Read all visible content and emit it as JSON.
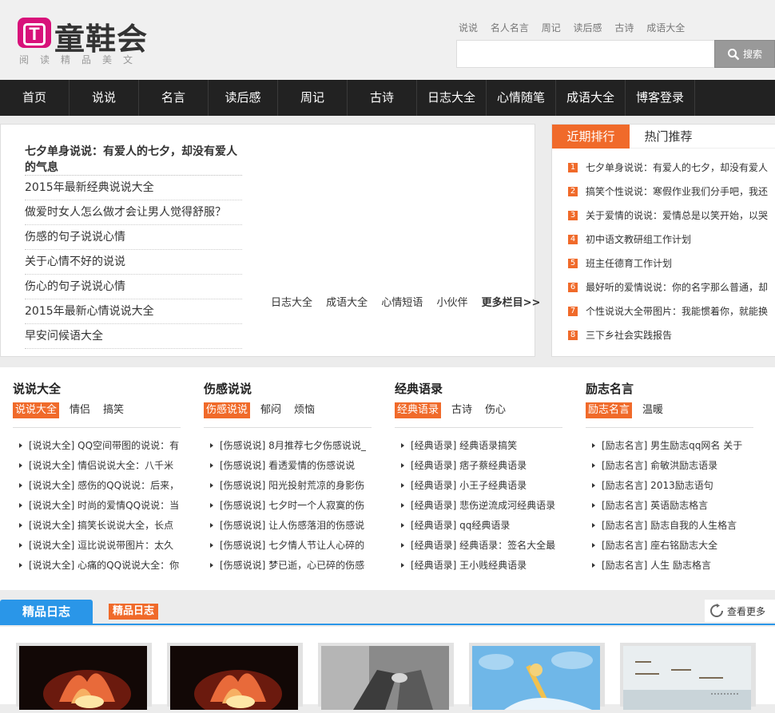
{
  "header": {
    "logo_letter": "T",
    "logo_name": "童鞋会",
    "logo_sub": "阅读精品美文",
    "brand_color": "#d8117a",
    "toplinks": [
      "说说",
      "名人名言",
      "周记",
      "读后感",
      "古诗",
      "成语大全"
    ],
    "search_placeholder": "",
    "search_label": "搜索"
  },
  "nav": [
    "首页",
    "说说",
    "名言",
    "读后感",
    "周记",
    "古诗",
    "日志大全",
    "心情随笔",
    "成语大全",
    "博客登录"
  ],
  "featured": {
    "title": "七夕单身说说：有爱人的七夕，却没有爱人的气息",
    "items": [
      "2015年最新经典说说大全",
      "做爱时女人怎么做才会让男人觉得舒服？",
      "伤感的句子说说心情",
      "关于心情不好的说说",
      "伤心的句子说说心情",
      "2015年最新心情说说大全",
      "早安问候语大全"
    ],
    "more_links": [
      "日志大全",
      "成语大全",
      "心情短语",
      "小伙伴"
    ],
    "more_label": "更多栏目>>"
  },
  "ranking": {
    "tabs": [
      "近期排行",
      "热门推荐"
    ],
    "items": [
      "七夕单身说说：有爱人的七夕，却没有爱人",
      "搞笑个性说说：寒假作业我们分手吧，我还",
      "关于爱情的说说：爱情总是以笑开始，以哭",
      "初中语文教研组工作计划",
      "班主任德育工作计划",
      "最好听的爱情说说：你的名字那么普通，却",
      "个性说说大全带图片：我能惯着你，就能换",
      "三下乡社会实践报告"
    ]
  },
  "columns": [
    {
      "title": "说说大全",
      "tags": [
        "说说大全",
        "情侣",
        "搞笑"
      ],
      "items": [
        "[说说大全] QQ空间带图的说说：有",
        "[说说大全] 情侣说说大全：八千米",
        "[说说大全] 感伤的QQ说说：后来，",
        "[说说大全] 时尚的爱情QQ说说：当",
        "[说说大全] 搞笑长说说大全，长点",
        "[说说大全] 逗比说说带图片：太久",
        "[说说大全] 心痛的QQ说说大全：你"
      ]
    },
    {
      "title": "伤感说说",
      "tags": [
        "伤感说说",
        "郁闷",
        "烦恼"
      ],
      "items": [
        "[伤感说说] 8月推荐七夕伤感说说_",
        "[伤感说说] 看透爱情的伤感说说",
        "[伤感说说] 阳光投射荒凉的身影伤",
        "[伤感说说] 七夕时一个人寂寞的伤",
        "[伤感说说] 让人伤感落泪的伤感说",
        "[伤感说说] 七夕情人节让人心碎的",
        "[伤感说说] 梦已逝，心已碎的伤感"
      ]
    },
    {
      "title": "经典语录",
      "tags": [
        "经典语录",
        "古诗",
        "伤心"
      ],
      "items": [
        "[经典语录] 经典语录搞笑",
        "[经典语录] 痞子蔡经典语录",
        "[经典语录] 小王子经典语录",
        "[经典语录] 悲伤逆流成河经典语录",
        "[经典语录] qq经典语录",
        "[经典语录] 经典语录：签名大全最",
        "[经典语录] 王小贱经典语录"
      ]
    },
    {
      "title": "励志名言",
      "tags": [
        "励志名言",
        "温暖"
      ],
      "items": [
        "[励志名言] 男生励志qq网名 关于",
        "[励志名言] 俞敏洪励志语录",
        "[励志名言] 2013励志语句",
        "[励志名言] 英语励志格言",
        "[励志名言] 励志自我的人生格言",
        "[励志名言] 座右铭励志大全",
        "[励志名言] 人生 励志格言"
      ]
    }
  ],
  "jingpin": {
    "tab": "精品日志",
    "tag": "精品日志",
    "more": "查看更多"
  },
  "photos": [
    "lotus-candle-photo",
    "lotus-candle-photo",
    "holding-hands-photo",
    "cartoon-sky-photo",
    "calligraphy-photo"
  ],
  "accent": "#f06a2a",
  "blue": "#2a96e8"
}
